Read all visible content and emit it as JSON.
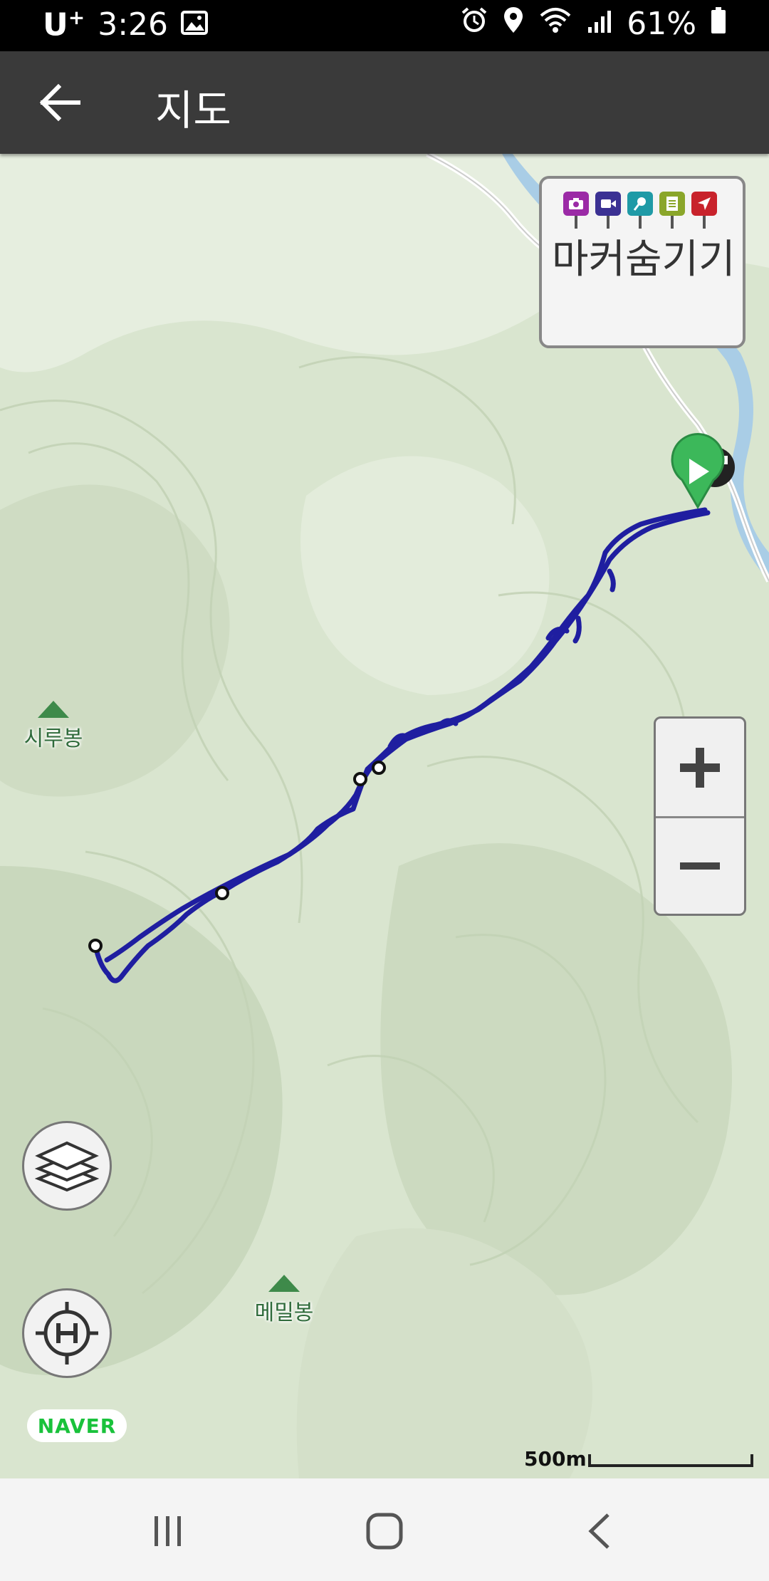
{
  "status_bar": {
    "carrier": "U",
    "carrier_sup": "+",
    "time": "3:26",
    "battery": "61%",
    "icons": [
      "image-icon",
      "alarm-icon",
      "location-icon",
      "wifi-icon",
      "signal-icon",
      "battery-icon"
    ]
  },
  "app_bar": {
    "title": "지도",
    "back_icon": "arrow-left-icon"
  },
  "map": {
    "marker_panel": {
      "label": "마커숨기기",
      "pins": [
        {
          "name": "camera-pin",
          "color": "#9b2aa6"
        },
        {
          "name": "video-pin",
          "color": "#3b3193"
        },
        {
          "name": "mic-pin",
          "color": "#1f9aa6"
        },
        {
          "name": "note-pin",
          "color": "#8aa62a"
        },
        {
          "name": "location-arrow-pin",
          "color": "#c8222b"
        }
      ]
    },
    "peaks": [
      {
        "name": "시루봉"
      },
      {
        "name": "메밀봉"
      }
    ],
    "track_color": "#1f1ea0",
    "start_marker_color": "#3cb85a",
    "zoom_in_label": "+",
    "zoom_out_label": "−",
    "brand": "NAVER",
    "scale_label": "500m"
  },
  "nav_bar": {
    "icons": [
      "recent-apps-icon",
      "home-icon",
      "back-icon"
    ]
  }
}
